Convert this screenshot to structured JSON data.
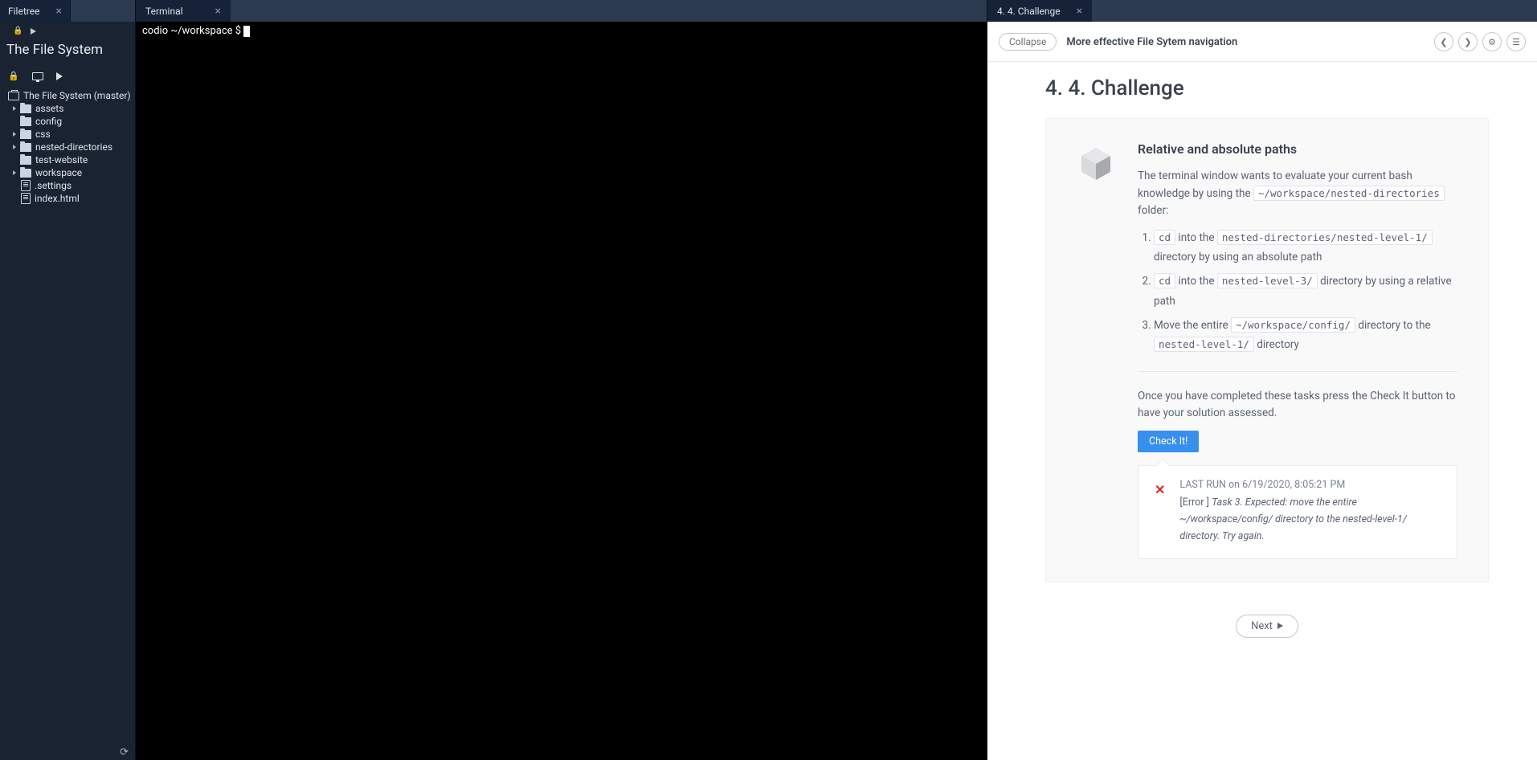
{
  "left": {
    "tab": "Filetree",
    "project_title": "The File System",
    "tree_root": "The File System (master)",
    "items": [
      {
        "name": "assets",
        "type": "folder",
        "expandable": true,
        "level": 2
      },
      {
        "name": "config",
        "type": "folder",
        "expandable": false,
        "level": 2
      },
      {
        "name": "css",
        "type": "folder",
        "expandable": true,
        "level": 2
      },
      {
        "name": "nested-directories",
        "type": "folder",
        "expandable": true,
        "level": 2
      },
      {
        "name": "test-website",
        "type": "folder",
        "expandable": false,
        "level": 2
      },
      {
        "name": "workspace",
        "type": "folder",
        "expandable": true,
        "level": 2
      },
      {
        "name": ".settings",
        "type": "file",
        "expandable": false,
        "level": 3
      },
      {
        "name": "index.html",
        "type": "file",
        "expandable": false,
        "level": 3
      }
    ]
  },
  "center": {
    "tab": "Terminal",
    "prompt": "codio ~/workspace $ "
  },
  "right": {
    "tab": "4. 4. Challenge",
    "collapse": "Collapse",
    "breadcrumb": "More effective File Sytem navigation",
    "title": "4. 4. Challenge",
    "card_title": "Relative and absolute paths",
    "intro_pre": "The terminal window wants to evaluate your current bash knowledge by using the ",
    "intro_code": "~/workspace/nested-directories",
    "intro_post": " folder:",
    "step1_a": " into the ",
    "step1_code1": "cd",
    "step1_code2": "nested-directories/nested-level-1/",
    "step1_b": " directory by using an absolute path",
    "step2_a": " into the ",
    "step2_code1": "cd",
    "step2_code2": "nested-level-3/",
    "step2_b": " directory by using a relative path",
    "step3_a": "Move the entire ",
    "step3_code1": "~/workspace/config/",
    "step3_b": " directory to the ",
    "step3_code2": "nested-level-1/",
    "step3_c": " directory",
    "completed": "Once you have completed these tasks press the Check It button to have your solution assessed.",
    "check": "Check It!",
    "last_run_label": "LAST RUN",
    "last_run_on": " on 6/19/2020, 8:05:21 PM",
    "error_prefix": "[Error  ] ",
    "error_msg": "Task 3. Expected: move the entire ~/workspace/config/ directory to the nested-level-1/ directory. Try again.",
    "next": "Next"
  }
}
